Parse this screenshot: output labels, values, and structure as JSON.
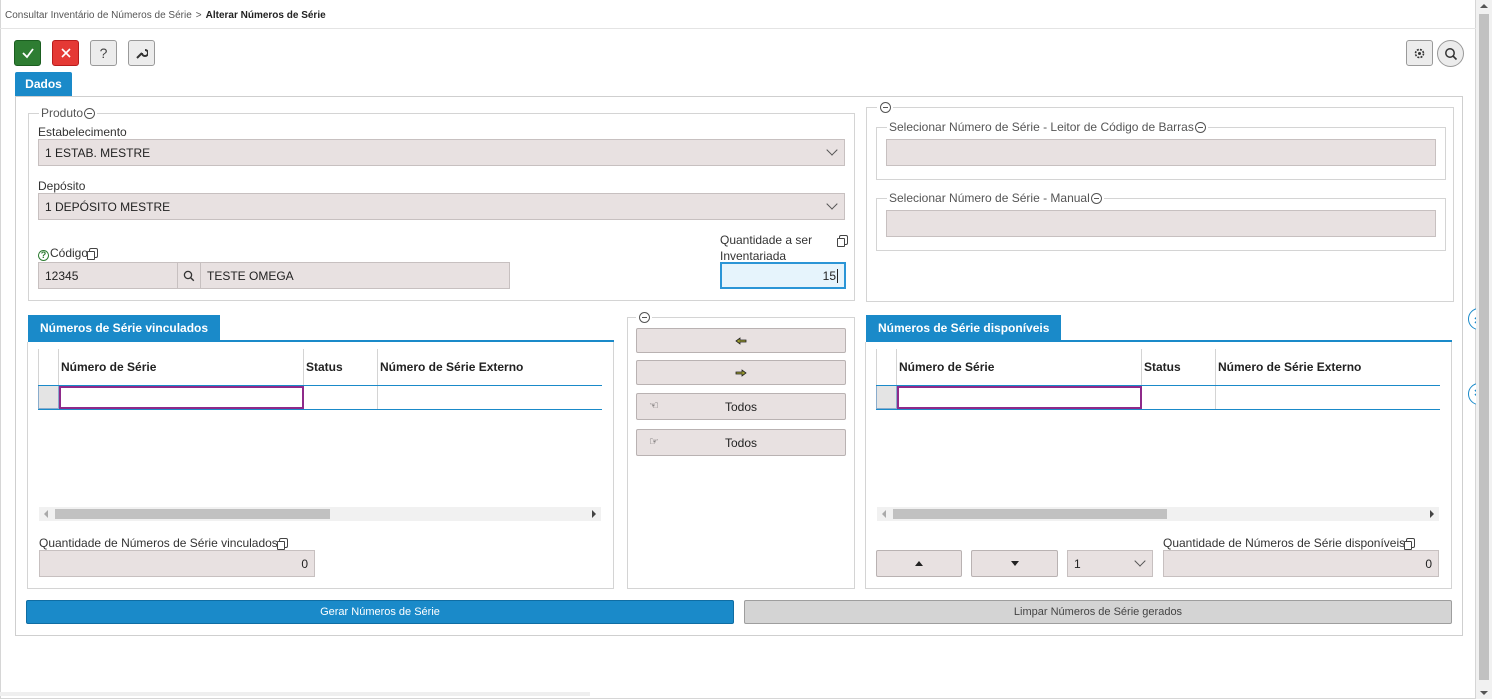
{
  "breadcrumb": {
    "parent": "Consultar Inventário de Números de Série",
    "separator": ">",
    "current": "Alterar Números de Série"
  },
  "toolbar": {
    "help_label": "?"
  },
  "tabs": {
    "dados": "Dados"
  },
  "produto": {
    "legend": "Produto",
    "estabelecimento_label": "Estabelecimento",
    "estabelecimento_value": "1 ESTAB. MESTRE",
    "deposito_label": "Depósito",
    "deposito_value": "1 DEPÓSITO MESTRE",
    "codigo_label": "Código",
    "codigo_value": "12345",
    "descricao_value": "TESTE OMEGA",
    "quantidade_label_line1": "Quantidade a ser",
    "quantidade_label_line2": "Inventariada",
    "quantidade_value": "15"
  },
  "selecionar": {
    "leitor_legend": "Selecionar Número de Série - Leitor de Código de Barras",
    "leitor_value": "",
    "manual_legend": "Selecionar Número de Série - Manual",
    "manual_value": ""
  },
  "vinculados": {
    "title": "Números de Série vinculados",
    "columns": [
      "Número de Série",
      "Status",
      "Número de Série Externo"
    ],
    "quantidade_label": "Quantidade de Números de Série vinculados",
    "quantidade_value": "0"
  },
  "actions": {
    "todos_1": "Todos",
    "todos_2": "Todos"
  },
  "disponiveis": {
    "title": "Números de Série disponíveis",
    "columns": [
      "Número de Série",
      "Status",
      "Número de Série Externo"
    ],
    "page_value": "1",
    "quantidade_label": "Quantidade de Números de Série disponíveis",
    "quantidade_value": "0"
  },
  "footer": {
    "gerar_label": "Gerar Números de Série",
    "limpar_label": "Limpar Números de Série gerados"
  },
  "colors": {
    "accent": "#1a8ac9",
    "confirm": "#2e7d32",
    "cancel": "#e53935",
    "field_bg": "#e8e1e1",
    "edit_border": "#8e2a8a"
  }
}
